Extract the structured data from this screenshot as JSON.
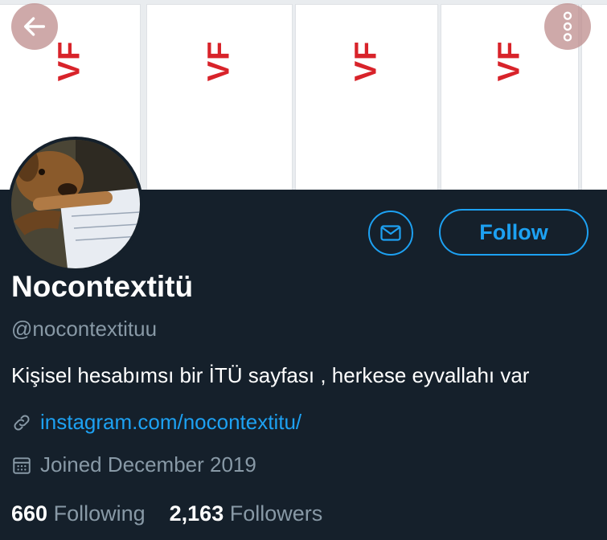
{
  "banner": {
    "panel_text": "VF",
    "panel_color": "#d8232a"
  },
  "nav": {
    "back_icon": "arrow-left-icon",
    "more_icon": "more-vertical-icon"
  },
  "actions": {
    "message_icon": "envelope-icon",
    "follow_label": "Follow"
  },
  "profile": {
    "name": "Nocontextitü",
    "handle": "@nocontextituu",
    "bio": "Kişisel hesabımsı bir İTÜ sayfası , herkese eyvallahı var",
    "link": "instagram.com/nocontextitu/",
    "joined": "Joined December 2019"
  },
  "stats": {
    "following_count": "660",
    "following_label": "Following",
    "followers_count": "2,163",
    "followers_label": "Followers"
  },
  "colors": {
    "background": "#15202b",
    "accent": "#1da1f2",
    "muted": "#8899a6"
  }
}
